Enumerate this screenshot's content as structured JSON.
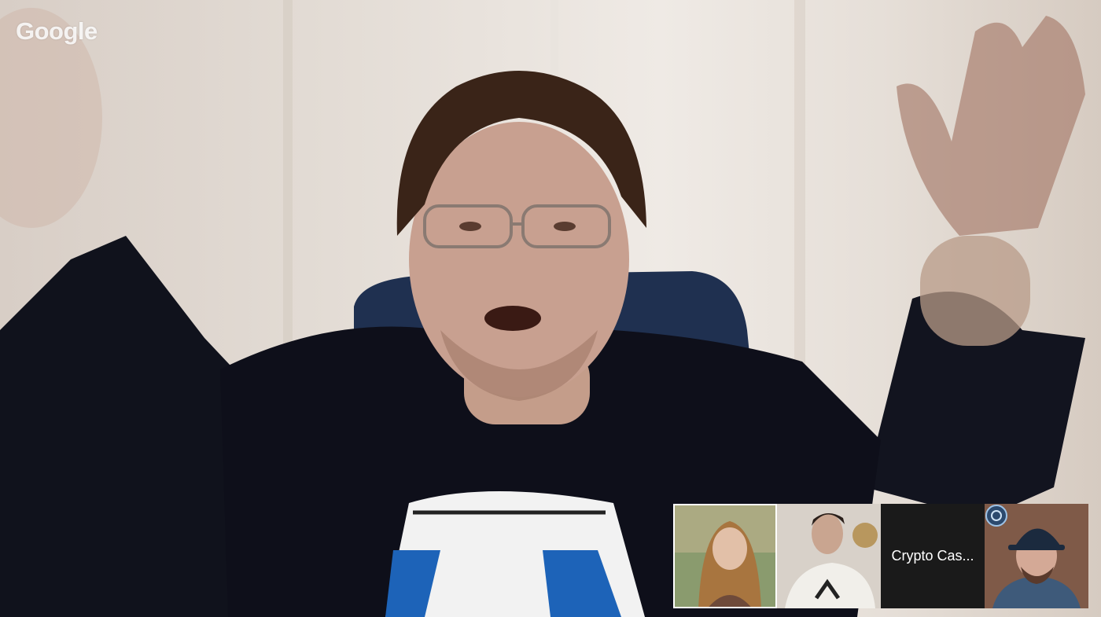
{
  "app": {
    "logo_text": "Google"
  },
  "main_video": {
    "participant": "main speaker"
  },
  "filmstrip": {
    "participants": [
      {
        "id": "p1",
        "label": ""
      },
      {
        "id": "p2",
        "label": ""
      },
      {
        "id": "p3",
        "label": "Crypto Cas..."
      },
      {
        "id": "p4",
        "label": ""
      }
    ]
  },
  "icons": {
    "logo": "google-logo",
    "badge": "broadcast-badge-icon"
  },
  "colors": {
    "shirt": "#0e0f1a",
    "name_tile_bg": "#1a1a1a",
    "name_text": "#ffffff"
  }
}
